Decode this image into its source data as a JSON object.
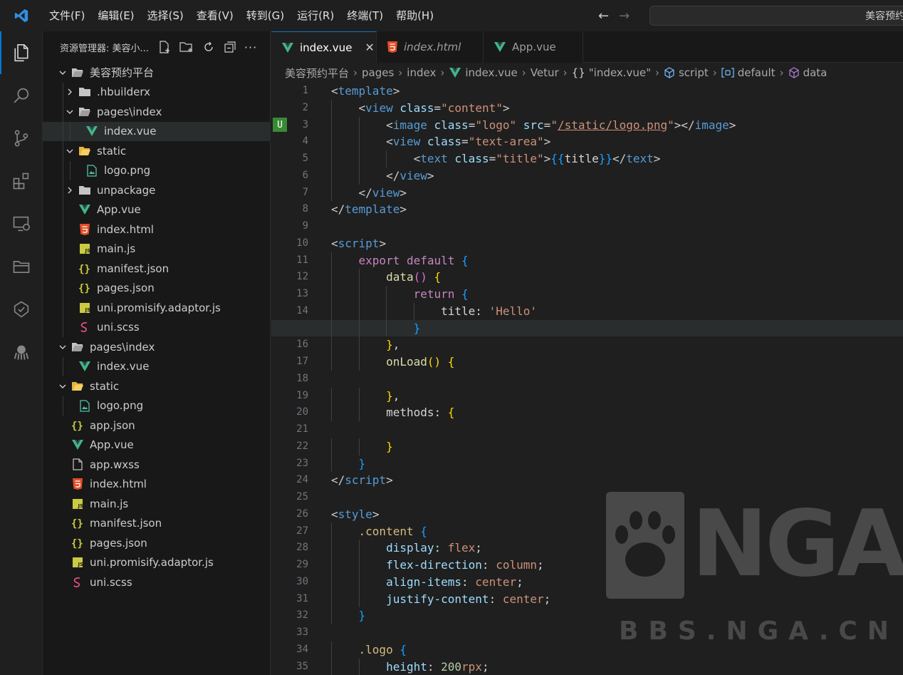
{
  "menu": [
    "文件(F)",
    "编辑(E)",
    "选择(S)",
    "查看(V)",
    "转到(G)",
    "运行(R)",
    "终端(T)",
    "帮助(H)"
  ],
  "search": {
    "text": "美容预约平台"
  },
  "sidebar": {
    "title": "资源管理器: 美容小...",
    "tree": [
      {
        "label": "美容预约平台",
        "type": "folder-open",
        "depth": 0
      },
      {
        "label": ".hbuilderx",
        "type": "folder-closed",
        "depth": 1
      },
      {
        "label": "pages\\index",
        "type": "folder-open",
        "depth": 1
      },
      {
        "label": "index.vue",
        "type": "vue",
        "depth": 2,
        "selected": true
      },
      {
        "label": "static",
        "type": "folder-static",
        "depth": 1
      },
      {
        "label": "logo.png",
        "type": "image",
        "depth": 2
      },
      {
        "label": "unpackage",
        "type": "folder-closed",
        "depth": 1
      },
      {
        "label": "App.vue",
        "type": "vue",
        "depth": 1
      },
      {
        "label": "index.html",
        "type": "html",
        "depth": 1
      },
      {
        "label": "main.js",
        "type": "js",
        "depth": 1
      },
      {
        "label": "manifest.json",
        "type": "json",
        "depth": 1
      },
      {
        "label": "pages.json",
        "type": "json",
        "depth": 1
      },
      {
        "label": "uni.promisify.adaptor.js",
        "type": "js",
        "depth": 1
      },
      {
        "label": "uni.scss",
        "type": "scss",
        "depth": 1
      },
      {
        "label": "pages\\index",
        "type": "folder-open",
        "depth": 0
      },
      {
        "label": "index.vue",
        "type": "vue",
        "depth": 1
      },
      {
        "label": "static",
        "type": "folder-static",
        "depth": 0
      },
      {
        "label": "logo.png",
        "type": "image",
        "depth": 1
      },
      {
        "label": "app.json",
        "type": "json",
        "depth": 0
      },
      {
        "label": "App.vue",
        "type": "vue",
        "depth": 0
      },
      {
        "label": "app.wxss",
        "type": "file",
        "depth": 0
      },
      {
        "label": "index.html",
        "type": "html",
        "depth": 0
      },
      {
        "label": "main.js",
        "type": "js",
        "depth": 0
      },
      {
        "label": "manifest.json",
        "type": "json",
        "depth": 0
      },
      {
        "label": "pages.json",
        "type": "json",
        "depth": 0
      },
      {
        "label": "uni.promisify.adaptor.js",
        "type": "js",
        "depth": 0
      },
      {
        "label": "uni.scss",
        "type": "scss",
        "depth": 0
      }
    ]
  },
  "tabs": [
    {
      "label": "index.vue",
      "icon": "vue",
      "active": true
    },
    {
      "label": "index.html",
      "icon": "html",
      "italic": true
    },
    {
      "label": "App.vue",
      "icon": "vue"
    }
  ],
  "breadcrumb": [
    "美容预约平台",
    "pages",
    "index",
    "index.vue",
    "Vetur",
    "\"index.vue\"",
    "script",
    "default",
    "data"
  ],
  "editor": {
    "current_line": 15,
    "lines": [
      [
        [
          "t-punct",
          "<"
        ],
        [
          "t-tag",
          "template"
        ],
        [
          "t-punct",
          ">"
        ]
      ],
      [
        [
          "t-punct",
          "    <"
        ],
        [
          "t-tag",
          "view"
        ],
        [
          "t-plain",
          " "
        ],
        [
          "t-attr",
          "class"
        ],
        [
          "t-punct",
          "="
        ],
        [
          "t-str",
          "\"content\""
        ],
        [
          "t-punct",
          ">"
        ]
      ],
      [
        [
          "t-punct",
          "        <"
        ],
        [
          "t-tag",
          "image"
        ],
        [
          "t-plain",
          " "
        ],
        [
          "t-attr",
          "class"
        ],
        [
          "t-punct",
          "="
        ],
        [
          "t-str",
          "\"logo\""
        ],
        [
          "t-plain",
          " "
        ],
        [
          "t-attr",
          "src"
        ],
        [
          "t-punct",
          "="
        ],
        [
          "t-str",
          "\""
        ],
        [
          "t-link",
          "/static/logo.png"
        ],
        [
          "t-str",
          "\""
        ],
        [
          "t-punct",
          "></"
        ],
        [
          "t-tag",
          "image"
        ],
        [
          "t-punct",
          ">"
        ]
      ],
      [
        [
          "t-punct",
          "        <"
        ],
        [
          "t-tag",
          "view"
        ],
        [
          "t-plain",
          " "
        ],
        [
          "t-attr",
          "class"
        ],
        [
          "t-punct",
          "="
        ],
        [
          "t-str",
          "\"text-area\""
        ],
        [
          "t-punct",
          ">"
        ]
      ],
      [
        [
          "t-punct",
          "            <"
        ],
        [
          "t-tag",
          "text"
        ],
        [
          "t-plain",
          " "
        ],
        [
          "t-attr",
          "class"
        ],
        [
          "t-punct",
          "="
        ],
        [
          "t-str",
          "\"title\""
        ],
        [
          "t-punct",
          ">"
        ],
        [
          "t-br3",
          "{{"
        ],
        [
          "t-plain",
          "title"
        ],
        [
          "t-br3",
          "}}"
        ],
        [
          "t-punct",
          "</"
        ],
        [
          "t-tag",
          "text"
        ],
        [
          "t-punct",
          ">"
        ]
      ],
      [
        [
          "t-punct",
          "        </"
        ],
        [
          "t-tag",
          "view"
        ],
        [
          "t-punct",
          ">"
        ]
      ],
      [
        [
          "t-punct",
          "    </"
        ],
        [
          "t-tag",
          "view"
        ],
        [
          "t-punct",
          ">"
        ]
      ],
      [
        [
          "t-punct",
          "</"
        ],
        [
          "t-tag",
          "template"
        ],
        [
          "t-punct",
          ">"
        ]
      ],
      [
        [
          "t-plain",
          ""
        ]
      ],
      [
        [
          "t-punct",
          "<"
        ],
        [
          "t-tag",
          "script"
        ],
        [
          "t-punct",
          ">"
        ]
      ],
      [
        [
          "t-plain",
          "    "
        ],
        [
          "tk-a",
          "export"
        ],
        [
          "t-plain",
          " "
        ],
        [
          "tk-a",
          "default"
        ],
        [
          "t-plain",
          " "
        ],
        [
          "t-br3",
          "{"
        ]
      ],
      [
        [
          "t-plain",
          "        "
        ],
        [
          "t-fn",
          "data"
        ],
        [
          "t-br2",
          "()"
        ],
        [
          "t-plain",
          " "
        ],
        [
          "t-br1",
          "{"
        ]
      ],
      [
        [
          "t-plain",
          "            "
        ],
        [
          "tk-a",
          "return"
        ],
        [
          "t-plain",
          " "
        ],
        [
          "t-br3",
          "{"
        ]
      ],
      [
        [
          "t-plain",
          "                title: "
        ],
        [
          "t-str",
          "'Hello'"
        ]
      ],
      [
        [
          "t-plain",
          "            "
        ],
        [
          "t-br3",
          "}"
        ]
      ],
      [
        [
          "t-plain",
          "        "
        ],
        [
          "t-br1",
          "}"
        ],
        [
          "t-plain",
          ","
        ]
      ],
      [
        [
          "t-plain",
          "        "
        ],
        [
          "t-fn",
          "onLoad"
        ],
        [
          "t-br1",
          "()"
        ],
        [
          "t-plain",
          " "
        ],
        [
          "t-br1",
          "{"
        ]
      ],
      [
        [
          "t-plain",
          ""
        ]
      ],
      [
        [
          "t-plain",
          "        "
        ],
        [
          "t-br1",
          "}"
        ],
        [
          "t-plain",
          ","
        ]
      ],
      [
        [
          "t-plain",
          "        methods: "
        ],
        [
          "t-br1",
          "{"
        ]
      ],
      [
        [
          "t-plain",
          ""
        ]
      ],
      [
        [
          "t-plain",
          "        "
        ],
        [
          "t-br1",
          "}"
        ]
      ],
      [
        [
          "t-plain",
          "    "
        ],
        [
          "t-br3",
          "}"
        ]
      ],
      [
        [
          "t-punct",
          "</"
        ],
        [
          "t-tag",
          "script"
        ],
        [
          "t-punct",
          ">"
        ]
      ],
      [
        [
          "t-plain",
          ""
        ]
      ],
      [
        [
          "t-punct",
          "<"
        ],
        [
          "t-tag",
          "style"
        ],
        [
          "t-punct",
          ">"
        ]
      ],
      [
        [
          "t-plain",
          "    "
        ],
        [
          "t-sel",
          ".content"
        ],
        [
          "t-plain",
          " "
        ],
        [
          "t-br3",
          "{"
        ]
      ],
      [
        [
          "t-plain",
          "        "
        ],
        [
          "t-prop",
          "display"
        ],
        [
          "t-plain",
          ": "
        ],
        [
          "t-val",
          "flex"
        ],
        [
          "t-plain",
          ";"
        ]
      ],
      [
        [
          "t-plain",
          "        "
        ],
        [
          "t-prop",
          "flex-direction"
        ],
        [
          "t-plain",
          ": "
        ],
        [
          "t-val",
          "column"
        ],
        [
          "t-plain",
          ";"
        ]
      ],
      [
        [
          "t-plain",
          "        "
        ],
        [
          "t-prop",
          "align-items"
        ],
        [
          "t-plain",
          ": "
        ],
        [
          "t-val",
          "center"
        ],
        [
          "t-plain",
          ";"
        ]
      ],
      [
        [
          "t-plain",
          "        "
        ],
        [
          "t-prop",
          "justify-content"
        ],
        [
          "t-plain",
          ": "
        ],
        [
          "t-val",
          "center"
        ],
        [
          "t-plain",
          ";"
        ]
      ],
      [
        [
          "t-plain",
          "    "
        ],
        [
          "t-br3",
          "}"
        ]
      ],
      [
        [
          "t-plain",
          ""
        ]
      ],
      [
        [
          "t-plain",
          "    "
        ],
        [
          "t-sel",
          ".logo"
        ],
        [
          "t-plain",
          " "
        ],
        [
          "t-br3",
          "{"
        ]
      ],
      [
        [
          "t-plain",
          "        "
        ],
        [
          "t-prop",
          "height"
        ],
        [
          "t-plain",
          ": "
        ],
        [
          "t-num",
          "200"
        ],
        [
          "t-val",
          "rpx"
        ],
        [
          "t-plain",
          ";"
        ]
      ]
    ]
  },
  "watermark": {
    "brand": "NGA",
    "url": "BBS.NGA.CN"
  },
  "colors": {
    "accent": "#0078d4",
    "vue": "#41b883",
    "html": "#e44d26",
    "js": "#cbcb41",
    "json": "#cbcb41",
    "scss": "#f55385"
  }
}
